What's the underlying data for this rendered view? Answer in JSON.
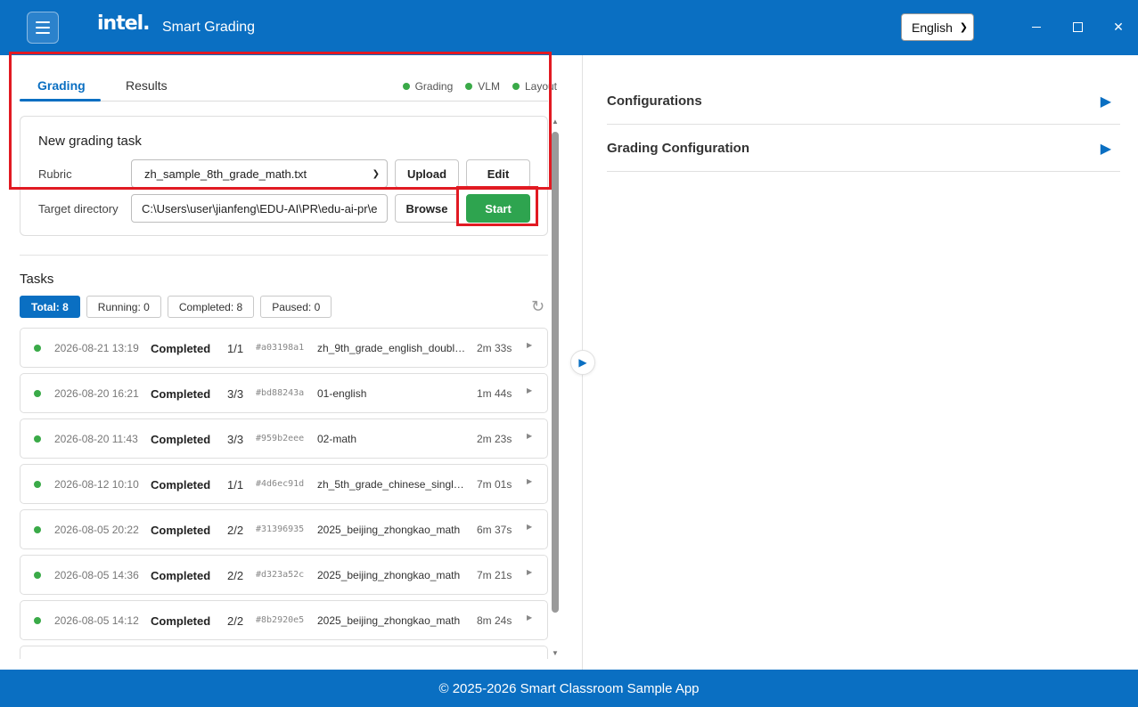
{
  "header": {
    "logo_text": "intel.",
    "app_title": "Smart Grading",
    "language": "English",
    "window_controls": [
      "minimize-icon",
      "maximize-icon",
      "close-icon"
    ]
  },
  "tabs": [
    {
      "label": "Grading",
      "active": true
    },
    {
      "label": "Results",
      "active": false
    }
  ],
  "status_indicators": [
    {
      "label": "Grading",
      "color": "#3aaa48"
    },
    {
      "label": "VLM",
      "color": "#3aaa48"
    },
    {
      "label": "Layout",
      "color": "#3aaa48"
    }
  ],
  "new_task": {
    "title": "New grading task",
    "rubric_label": "Rubric",
    "rubric_value": "zh_sample_8th_grade_math.txt",
    "target_label": "Target directory",
    "target_value": "C:\\Users\\user\\jianfeng\\EDU-AI\\PR\\edu-ai-pr\\e",
    "upload_label": "Upload",
    "edit_label": "Edit",
    "browse_label": "Browse",
    "start_label": "Start"
  },
  "tasks": {
    "title": "Tasks",
    "filters": [
      {
        "label": "Total: 8",
        "active": true
      },
      {
        "label": "Running: 0",
        "active": false
      },
      {
        "label": "Completed: 8",
        "active": false
      },
      {
        "label": "Paused: 0",
        "active": false
      }
    ],
    "items": [
      {
        "date": "2026-08-21 13:19",
        "status": "Completed",
        "count": "1/1",
        "hash": "#a03198a1",
        "name": "zh_9th_grade_english_double...",
        "duration": "2m 33s"
      },
      {
        "date": "2026-08-20 16:21",
        "status": "Completed",
        "count": "3/3",
        "hash": "#bd88243a",
        "name": "01-english",
        "duration": "1m 44s"
      },
      {
        "date": "2026-08-20 11:43",
        "status": "Completed",
        "count": "3/3",
        "hash": "#959b2eee",
        "name": "02-math",
        "duration": "2m 23s"
      },
      {
        "date": "2026-08-12 10:10",
        "status": "Completed",
        "count": "1/1",
        "hash": "#4d6ec91d",
        "name": "zh_5th_grade_chinese_single_...",
        "duration": "7m 01s"
      },
      {
        "date": "2026-08-05 20:22",
        "status": "Completed",
        "count": "2/2",
        "hash": "#31396935",
        "name": "2025_beijing_zhongkao_math",
        "duration": "6m 37s"
      },
      {
        "date": "2026-08-05 14:36",
        "status": "Completed",
        "count": "2/2",
        "hash": "#d323a52c",
        "name": "2025_beijing_zhongkao_math",
        "duration": "7m 21s"
      },
      {
        "date": "2026-08-05 14:12",
        "status": "Completed",
        "count": "2/2",
        "hash": "#8b2920e5",
        "name": "2025_beijing_zhongkao_math",
        "duration": "8m 24s"
      },
      {
        "date": "",
        "status": "",
        "count": "",
        "hash": "",
        "name": "",
        "duration": ""
      }
    ]
  },
  "right_panel": {
    "sections": [
      {
        "title": "Configurations"
      },
      {
        "title": "Grading Configuration"
      }
    ]
  },
  "footer": {
    "text": "© 2025-2026 Smart Classroom Sample App"
  },
  "colors": {
    "primary": "#0a6fc2",
    "success": "#2ea44f",
    "highlight": "#e11a22"
  }
}
